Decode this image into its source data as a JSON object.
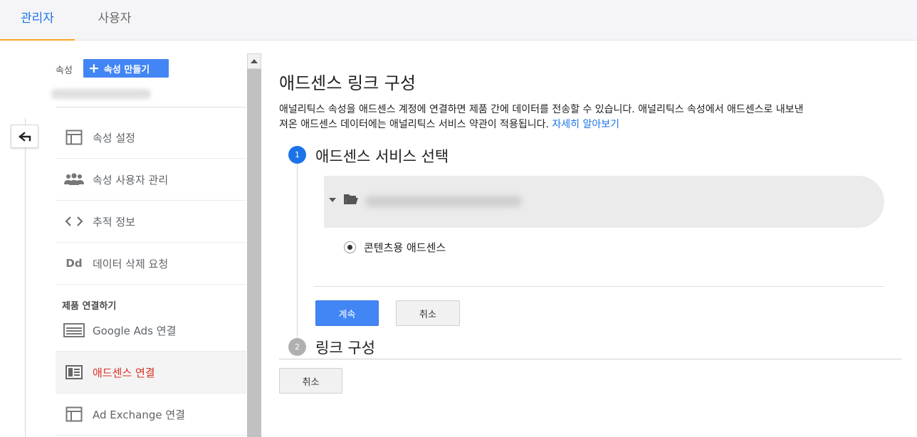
{
  "tabs": [
    {
      "label": "관리자",
      "active": true
    },
    {
      "label": "사용자",
      "active": false
    }
  ],
  "sidebar": {
    "property_label": "속성",
    "create_button_label": "속성 만들기",
    "items": [
      {
        "label": "속성 설정",
        "icon": "property-settings-icon"
      },
      {
        "label": "속성 사용자 관리",
        "icon": "users-group-icon"
      },
      {
        "label": "추적 정보",
        "icon": "code-icon"
      },
      {
        "label": "데이터 삭제 요청",
        "icon": "dd-icon"
      }
    ],
    "section_title": "제품 연결하기",
    "link_items": [
      {
        "label": "Google Ads 연결",
        "icon": "google-ads-icon"
      },
      {
        "label": "애드센스 연결",
        "icon": "adsense-icon",
        "active": true
      },
      {
        "label": "Ad Exchange 연결",
        "icon": "ad-exchange-icon"
      }
    ]
  },
  "main": {
    "title": "애드센스 링크 구성",
    "description_line1": "애널리틱스 속성을 애드센스 계정에 연결하면 제품 간에 데이터를 전송할 수 있습니다. 애널리틱스 속성에서 애드센스로 내보낸",
    "description_line2": "져온 애드센스 데이터에는 애널리틱스 서비스 약관이 적용됩니다.",
    "learn_more": "자세히 알아보기",
    "step1": {
      "number": "1",
      "title": "애드센스 서비스 선택"
    },
    "radio_label": "콘텐츠용 애드센스",
    "continue_label": "계속",
    "cancel_label": "취소",
    "step2": {
      "number": "2",
      "title": "링크 구성"
    },
    "cancel2_label": "취소"
  },
  "colors": {
    "accent": "#1a73e8",
    "button_blue": "#4285f4",
    "active_red": "#d93025",
    "tab_underline": "#f6a623"
  }
}
